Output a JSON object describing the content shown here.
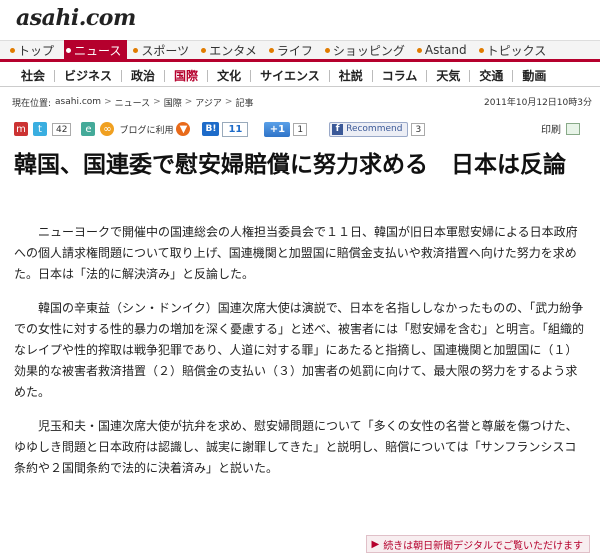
{
  "brand": {
    "logo": "asahi.com"
  },
  "topnav": [
    {
      "label": "トップ",
      "active": false
    },
    {
      "label": "ニュース",
      "active": true
    },
    {
      "label": "スポーツ",
      "active": false
    },
    {
      "label": "エンタメ",
      "active": false
    },
    {
      "label": "ライフ",
      "active": false
    },
    {
      "label": "ショッピング",
      "active": false
    },
    {
      "label": "Astand",
      "active": false
    },
    {
      "label": "トピックス",
      "active": false
    }
  ],
  "subnav": [
    {
      "label": "社会"
    },
    {
      "label": "ビジネス"
    },
    {
      "label": "政治"
    },
    {
      "label": "国際",
      "active": true
    },
    {
      "label": "文化"
    },
    {
      "label": "サイエンス"
    },
    {
      "label": "社説"
    },
    {
      "label": "コラム"
    },
    {
      "label": "天気"
    },
    {
      "label": "交通"
    },
    {
      "label": "動画"
    }
  ],
  "breadcrumb": {
    "label": "現在位置:",
    "items": [
      "asahi.com",
      "ニュース",
      "国際",
      "アジア",
      "記事"
    ],
    "sep": ">",
    "date": "2011年10月12日10時3分"
  },
  "social": {
    "twitter_count": "42",
    "blog_label": "ブログに利用",
    "hatena_label": "B!",
    "hatena_count": "11",
    "gplus_label": "+1",
    "gplus_count": "1",
    "fb_label": "Recommend",
    "fb_count": "3",
    "print_label": "印刷"
  },
  "article": {
    "title": "韓国、国連委で慰安婦賠償に努力求める　日本は反論",
    "paragraphs": [
      "ニューヨークで開催中の国連総会の人権担当委員会で１１日、韓国が旧日本軍慰安婦による日本政府への個人請求権問題について取り上げ、国連機関と加盟国に賠償金支払いや救済措置へ向けた努力を求めた。日本は「法的に解決済み」と反論した。",
      "韓国の辛東益（シン・ドンイク）国連次席大使は演説で、日本を名指ししなかったものの、「武力紛争での女性に対する性的暴力の増加を深く憂慮する」と述べ、被害者には「慰安婦を含む」と明言。「組織的なレイプや性的搾取は戦争犯罪であり、人道に対する罪」にあたると指摘し、国連機関と加盟国に（１）効果的な被害者救済措置（２）賠償金の支払い（３）加害者の処罰に向けて、最大限の努力をするよう求めた。",
      "児玉和夫・国連次席大使が抗弁を求め、慰安婦問題について「多くの女性の名誉と尊厳を傷つけた、ゆゆしき問題と日本政府は認識し、誠実に謝罪してきた」と説明し、賠償については「サンフランシスコ条約や２国間条約で法的に決着済み」と説いた。"
    ]
  },
  "more_button": "続きは朝日新聞デジタルでご覧いただけます",
  "colors": {
    "accent": "#b5002d",
    "nav_dot": "#e07b00"
  }
}
